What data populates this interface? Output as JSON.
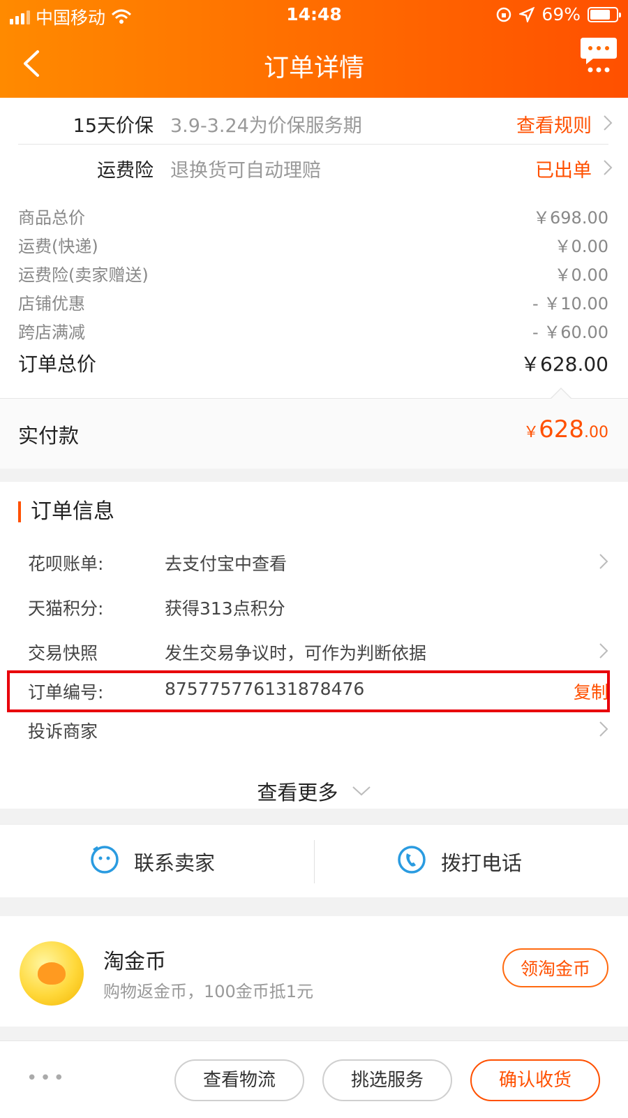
{
  "status": {
    "carrier": "中国移动",
    "time": "14:48",
    "battery": "69%"
  },
  "nav": {
    "title": "订单详情"
  },
  "services": [
    {
      "label": "15天价保",
      "desc": "3.9-3.24为价保服务期",
      "action": "查看规则"
    },
    {
      "label": "运费险",
      "desc": "退换货可自动理赔",
      "action": "已出单"
    }
  ],
  "prices": [
    {
      "label": "商品总价",
      "value": "￥698.00"
    },
    {
      "label": "运费(快递)",
      "value": "￥0.00"
    },
    {
      "label": "运费险(卖家赠送)",
      "value": "￥0.00"
    },
    {
      "label": "店铺优惠",
      "value": "- ￥10.00"
    },
    {
      "label": "跨店满减",
      "value": "- ￥60.00"
    }
  ],
  "total": {
    "label": "订单总价",
    "value": "￥628.00"
  },
  "paid": {
    "label": "实付款",
    "currency": "￥",
    "integer": "628",
    "decimal": ".00"
  },
  "order_info": {
    "title": "订单信息",
    "rows": [
      {
        "key": "花呗账单:",
        "value": "去支付宝中查看"
      },
      {
        "key": "天猫积分:",
        "value": "获得313点积分"
      },
      {
        "key": "交易快照",
        "value": "发生交易争议时，可作为判断依据"
      },
      {
        "key": "订单编号:",
        "value": "875775776131878476",
        "action": "复制"
      },
      {
        "key": "投诉商家",
        "value": ""
      }
    ],
    "more": "查看更多"
  },
  "contact": {
    "seller": "联系卖家",
    "phone": "拨打电话"
  },
  "coins": {
    "title": "淘金币",
    "subtitle": "购物返金币，100金币抵1元",
    "button": "领淘金币"
  },
  "bottom": {
    "logistics": "查看物流",
    "service": "挑选服务",
    "confirm": "确认收货"
  },
  "colors": {
    "accent": "#ff5000",
    "header_gradient_start": "#ff8a00",
    "highlight_border": "#e8000b"
  }
}
